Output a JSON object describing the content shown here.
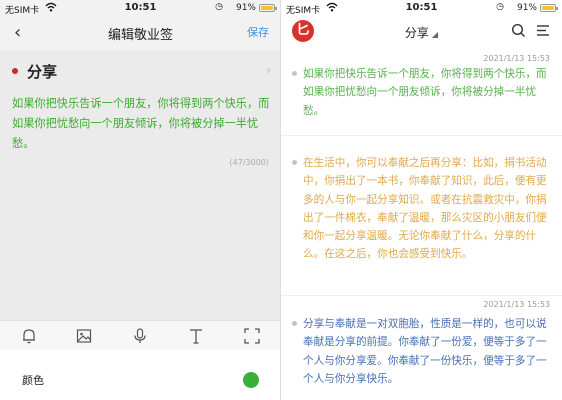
{
  "status": {
    "carrier": "无SIM卡",
    "time": "10:51",
    "battery": "91%",
    "battery_level": 0.91,
    "battery_color": "#f6c233"
  },
  "editor": {
    "back_icon": "chevron-left-icon",
    "title": "编辑敬业签",
    "save_label": "保存",
    "category": "分享",
    "category_dot_color": "#c62a2a",
    "text": "如果你把快乐告诉一个朋友，你将得到两个快乐，而如果你把忧愁向一个朋友倾诉，你将被分掉一半忧愁。",
    "text_color": "#3bab2f",
    "counter": "(47/3000)",
    "toolbar": [
      "alarm-bell-icon",
      "image-icon",
      "microphone-icon",
      "text-style-icon",
      "fullscreen-icon"
    ],
    "color_label": "颜色",
    "color_value": "#3ab03a"
  },
  "list": {
    "title": "分享",
    "avatar_glyph": "匕",
    "notes": [
      {
        "timestamp": "2021/1/13 15:53",
        "text": "如果你把快乐告诉一个朋友，你将得到两个快乐，而如果你把忧愁向一个朋友倾诉，你将被分掉一半忧愁。",
        "color": "#56b24a"
      },
      {
        "timestamp": "",
        "text": "在生活中，你可以奉献之后再分享：比如，捐书活动中，你捐出了一本书，你奉献了知识，此后，便有更多的人与你一起分享知识。或者在抗震救灾中，你捐出了一件棉衣，奉献了温暖，那么灾区的小朋友们便和你一起分享温暖。无论你奉献了什么，分享的什么。在这之后，你也会感受到快乐。",
        "color": "#e0a94b"
      },
      {
        "timestamp": "2021/1/13 15:53",
        "text": "分享与奉献是一对双胞胎，性质是一样的，也可以说奉献是分享的前提。你奉献了一份爱，便等于多了一个人与你分享爱。你奉献了一份快乐，便等于多了一个人与你分享快乐。",
        "color": "#4a6fb5"
      }
    ]
  }
}
